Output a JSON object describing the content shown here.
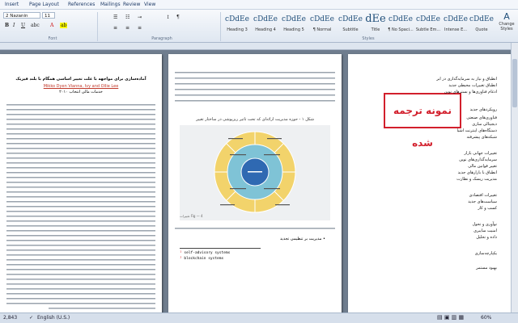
{
  "menu": {
    "tabs": [
      "Insert",
      "Page Layout",
      "References",
      "Mailings",
      "Review",
      "View"
    ]
  },
  "ribbon": {
    "font_name": "2 Nazanin",
    "font_size": "11",
    "group_font": "Font",
    "group_paragraph": "Paragraph",
    "group_styles": "Styles",
    "change_styles_line1": "Change",
    "change_styles_line2": "Styles",
    "styles": [
      {
        "preview": "cDdEe",
        "name": "Heading 3"
      },
      {
        "preview": "cDdEe",
        "name": "Heading 4"
      },
      {
        "preview": "cDdEe",
        "name": "Heading 5"
      },
      {
        "preview": "cDdEe",
        "name": "¶ Normal"
      },
      {
        "preview": "cDdEe",
        "name": "Subtitle"
      },
      {
        "preview": "dEe",
        "name": "Title"
      },
      {
        "preview": "cDdEe",
        "name": "¶ No Spaci..."
      },
      {
        "preview": "cDdEe",
        "name": "Subtle Em..."
      },
      {
        "preview": "cDdEe",
        "name": "Intense E..."
      },
      {
        "preview": "cDdEe",
        "name": "Quote"
      }
    ]
  },
  "left_page": {
    "title": "آمادەسازی برای مواجهه با علت تغییر اساسی همگام با بلند فیزیک",
    "authors": "Mikko Dyen Vianna, Ivy and Ollie Lee",
    "affiliation": "خدمات مالی انتخاب ۲۰۱۰"
  },
  "middle_page": {
    "fig_title": "شکل ۱ - حوزه مدیریت ارائه‌ای که تحت تاثیر ریزپوشی در ساختار تغییر",
    "chart_footer": "Fig — 4 تغییرات",
    "bullet_text": "مدیریت بر تنظیمی تجدید",
    "code_line1": "self-advisory systems",
    "code_line2": "blockchain systems"
  },
  "right_page": {
    "stamp_text": "نمونه ترجمه شده",
    "items": [
      "انطباق و نیاز به سرمایه‌گذاری در ابر",
      "انطباق تغییرات محیطی جدید",
      "ادغام فناوری‌ها و بسترهای نوین",
      "رویکردهای جدید",
      "فناوری‌های صنعتی",
      "دیجیتالی سازی",
      "دستگاه‌های اینترنت اشیا",
      "شبکه‌های پیشرفته",
      "تغییرات جهانی بازار",
      "سرمایه‌گذاری‌های نوین",
      "تغییر قوانین مالی",
      "انطباق با بازارهای جدید",
      "مدیریت ریسک و نظارت",
      "تغییرات اقتصادی",
      "سیاست‌های جدید",
      "کسب و کار",
      "نوآوری و تحول",
      "امنیت سایبری",
      "داده و تحلیل",
      "یکپارچه‌سازی",
      "بهبود مستمر"
    ]
  },
  "status": {
    "words": "2,843",
    "language": "English (U.S.)",
    "zoom": "60%"
  }
}
